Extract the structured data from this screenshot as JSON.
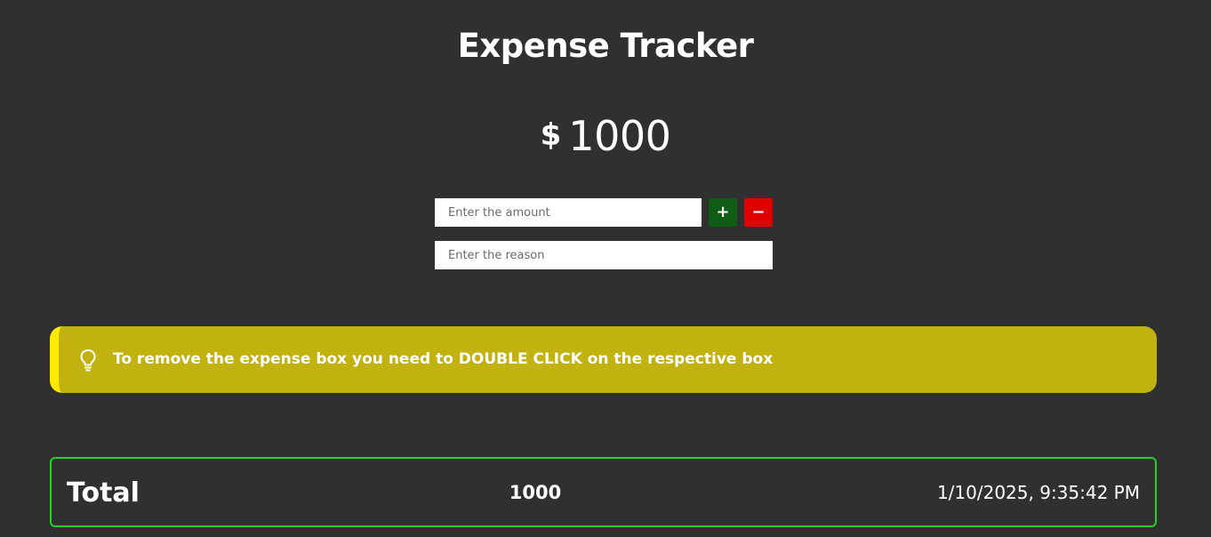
{
  "header": {
    "title": "Expense Tracker"
  },
  "balance": {
    "currency_symbol": "$",
    "amount": "1000"
  },
  "form": {
    "amount_placeholder": "Enter the amount",
    "amount_value": "",
    "reason_placeholder": "Enter the reason",
    "reason_value": "",
    "add_label": "+",
    "subtract_label": "−"
  },
  "tip": {
    "icon": "lightbulb-icon",
    "text": "To remove the expense box you need to DOUBLE CLICK on the respective box"
  },
  "entries": [
    {
      "label": "Total",
      "value": "1000",
      "timestamp": "1/10/2025, 9:35:42 PM"
    }
  ],
  "colors": {
    "background": "#303030",
    "add_button": "#0f5c14",
    "subtract_button": "#e00000",
    "tip_background": "#c2b20f",
    "tip_accent": "#ffe900",
    "entry_border": "#2ecc2e"
  }
}
